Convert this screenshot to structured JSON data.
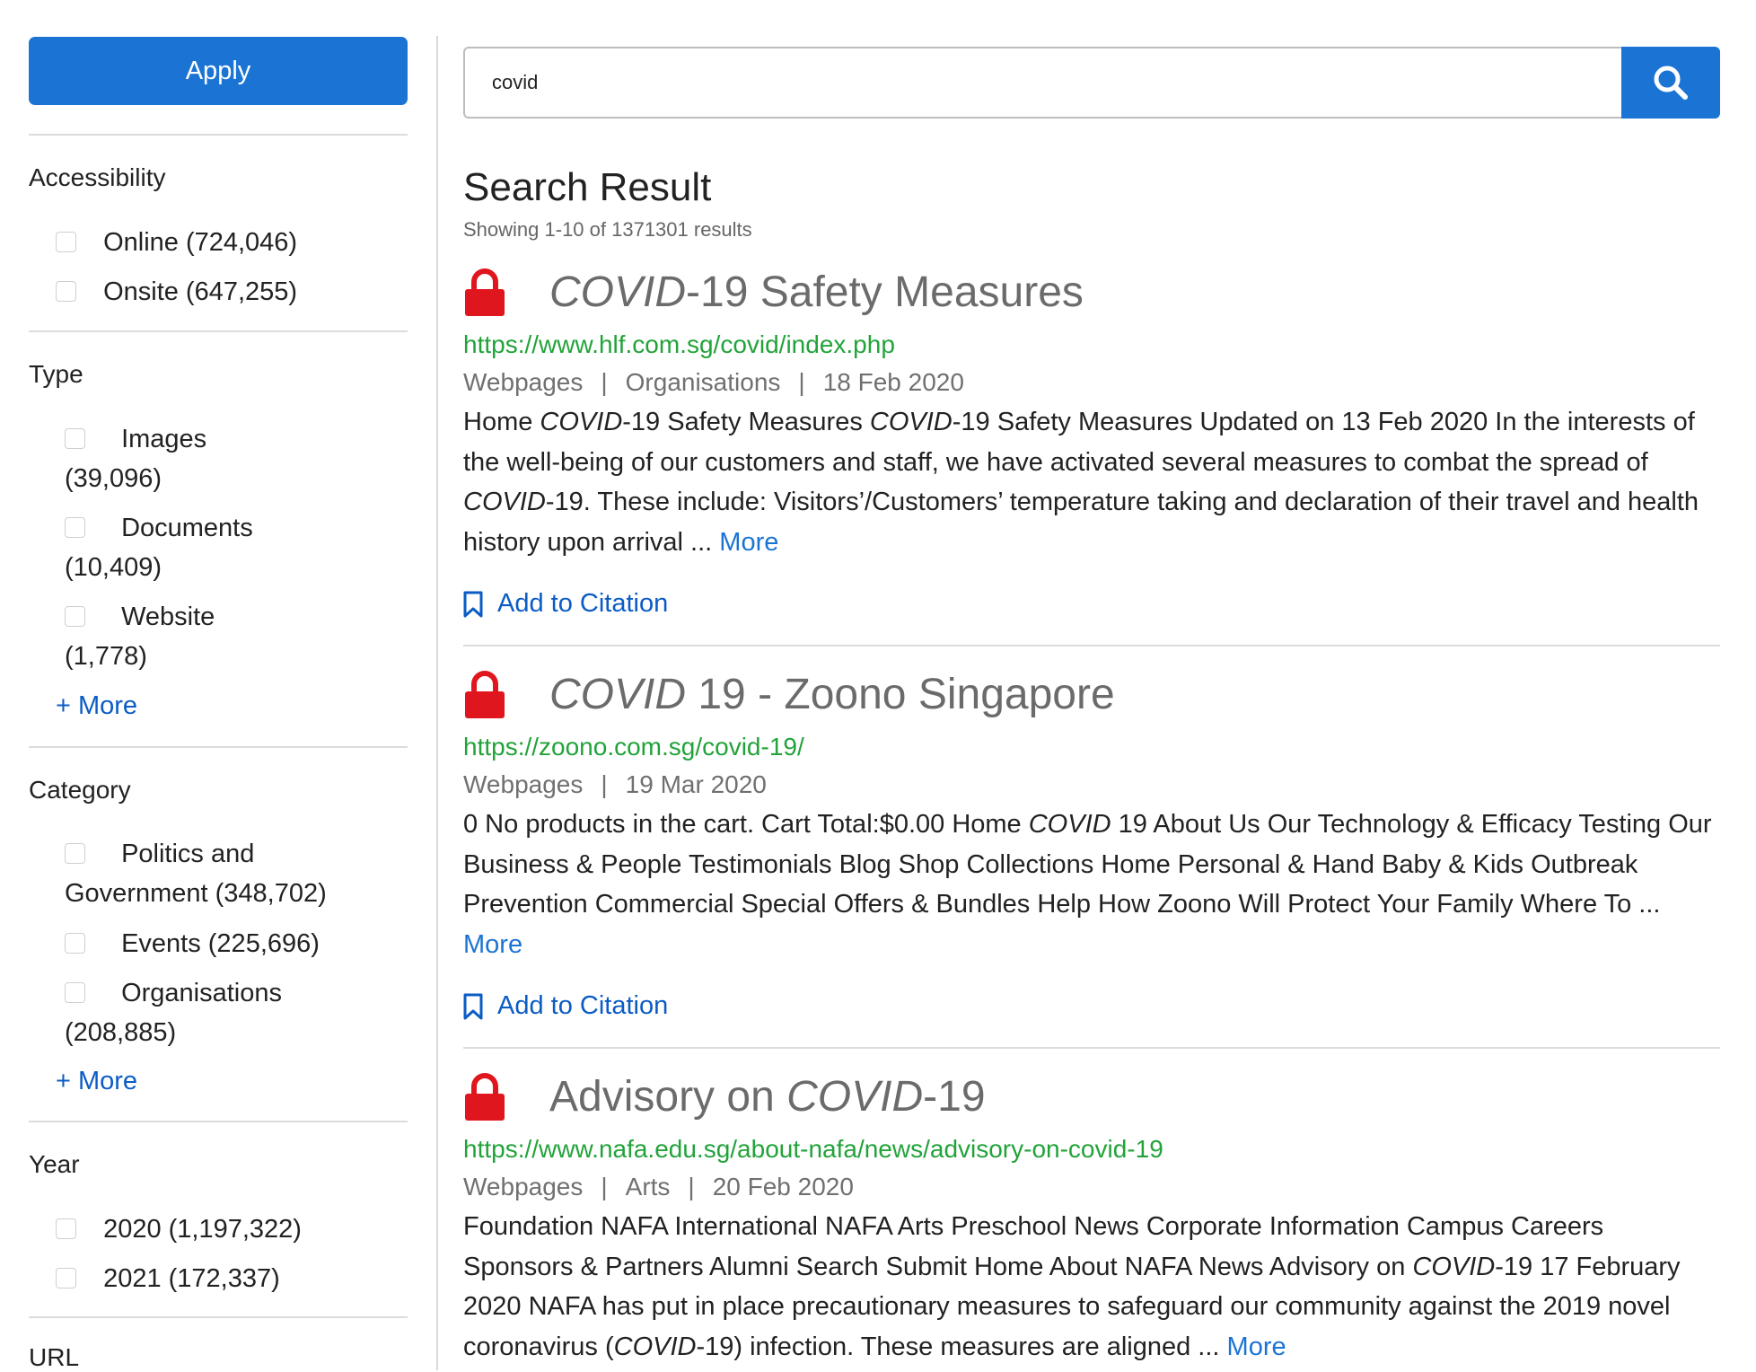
{
  "sidebar": {
    "apply_label": "Apply",
    "facets": [
      {
        "title": "Accessibility",
        "options": [
          "Online (724,046)",
          "Onsite (647,255)"
        ]
      },
      {
        "title": "Type",
        "options": [
          {
            "line1": "Images",
            "line2": "(39,096)"
          },
          {
            "line1": "Documents",
            "line2": "(10,409)"
          },
          {
            "line1": "Website",
            "line2": "(1,778)"
          }
        ],
        "more_label": "+ More"
      },
      {
        "title": "Category",
        "options": [
          {
            "line1": "Politics and",
            "line2": "Government (348,702)"
          },
          {
            "line1": "Events (225,696)",
            "line2": ""
          },
          {
            "line1": "Organisations",
            "line2": "(208,885)"
          }
        ],
        "more_label": "+ More"
      },
      {
        "title": "Year",
        "options": [
          "2020 (1,197,322)",
          "2021 (172,337)"
        ]
      },
      {
        "title": "URL"
      }
    ]
  },
  "search": {
    "query": "covid",
    "button_icon": "search-icon"
  },
  "results_header": {
    "title": "Search Result",
    "showing": "Showing 1-10 of 1371301 results"
  },
  "results": [
    {
      "title_em": "COVID",
      "title_rest": "-19 Safety Measures",
      "url": "https://www.hlf.com.sg/covid/index.php",
      "meta": [
        "Webpages",
        "Organisations",
        "18 Feb 2020"
      ],
      "snippet": {
        "p1": "Home ",
        "e1": "COVID",
        "p2": "-19 Safety Measures ",
        "e2": "COVID",
        "p3": "-19 Safety Measures Updated on 13 Feb 2020 In the interests of the well-being of our customers and staff, we have activated several measures to combat the spread of ",
        "e3": "COVID",
        "p4": "-19. These include: Visitors’/Customers’ temperature taking and declaration of their travel and health history upon arrival ... "
      },
      "more_label": "More",
      "cite_label": "Add to Citation"
    },
    {
      "title_em": "COVID",
      "title_rest": " 19 - Zoono Singapore",
      "url": "https://zoono.com.sg/covid-19/",
      "meta": [
        "Webpages",
        "19 Mar 2020"
      ],
      "snippet": {
        "p1": "0 No products in the cart. Cart Total:$0.00 Home ",
        "e1": "COVID",
        "p2": " 19 About Us Our Technology & Efficacy Testing Our Business & People Testimonials Blog Shop Collections Home Personal & Hand Baby & Kids Outbreak Prevention Commercial Special Offers & Bundles Help How Zoono Will Protect Your Family Where To ... "
      },
      "more_label": "More",
      "cite_label": "Add to Citation"
    },
    {
      "title_pre": "Advisory on ",
      "title_em": "COVID",
      "title_rest": "-19",
      "url": "https://www.nafa.edu.sg/about-nafa/news/advisory-on-covid-19",
      "meta": [
        "Webpages",
        "Arts",
        "20 Feb 2020"
      ],
      "snippet": {
        "p1": "Foundation NAFA International NAFA Arts Preschool News Corporate Information Campus Careers Sponsors & Partners Alumni Search Submit Home About NAFA News Advisory on ",
        "e1": "COVID",
        "p2": "-19 17 February 2020 NAFA has put in place precautionary measures to safeguard our community against the 2019 novel coronavirus (",
        "e2": "COVID",
        "p3": "-19) infection. These measures are aligned ... "
      },
      "more_label": "More"
    }
  ]
}
